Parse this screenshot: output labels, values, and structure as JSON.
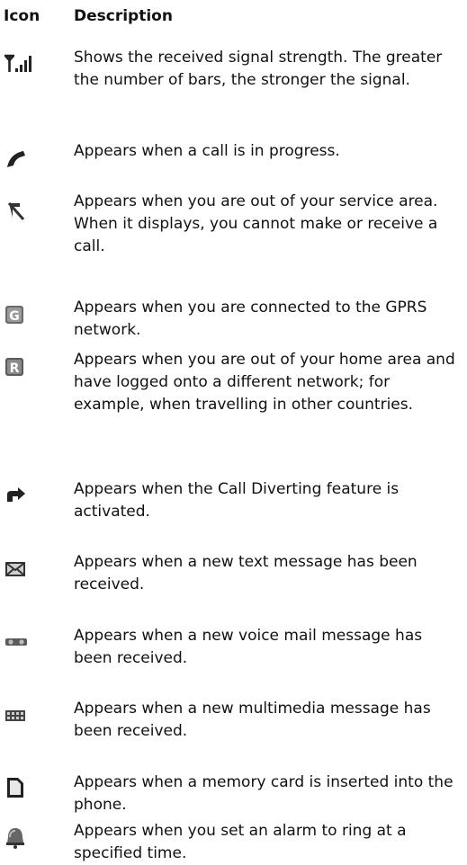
{
  "header": {
    "icon_label": "Icon",
    "description_label": "Description"
  },
  "rows": [
    {
      "icon": "signal-strength-icon",
      "text": "Shows the received signal strength. The greater the number of bars, the stronger the signal."
    },
    {
      "icon": "call-in-progress-icon",
      "text": "Appears when a call is in progress."
    },
    {
      "icon": "no-service-icon",
      "text": "Appears when you are out of your service area. When it displays, you cannot make or receive a call."
    },
    {
      "icon": "gprs-icon",
      "text": "Appears when you are connected to the GPRS network."
    },
    {
      "icon": "roaming-icon",
      "text": "Appears when you are out of your home area and have logged onto a different network; for example, when travelling in other countries."
    },
    {
      "icon": "call-divert-icon",
      "text": "Appears when the Call Diverting feature is activated."
    },
    {
      "icon": "text-message-icon",
      "text": "Appears when a new text message has been received."
    },
    {
      "icon": "voice-mail-icon",
      "text": "Appears when a new voice mail message has been received."
    },
    {
      "icon": "multimedia-message-icon",
      "text": "Appears when a new multimedia message has been received."
    },
    {
      "icon": "memory-card-icon",
      "text": "Appears when a memory card is inserted into the phone."
    },
    {
      "icon": "alarm-icon",
      "text": "Appears when you set an alarm to ring at a specified time."
    }
  ]
}
